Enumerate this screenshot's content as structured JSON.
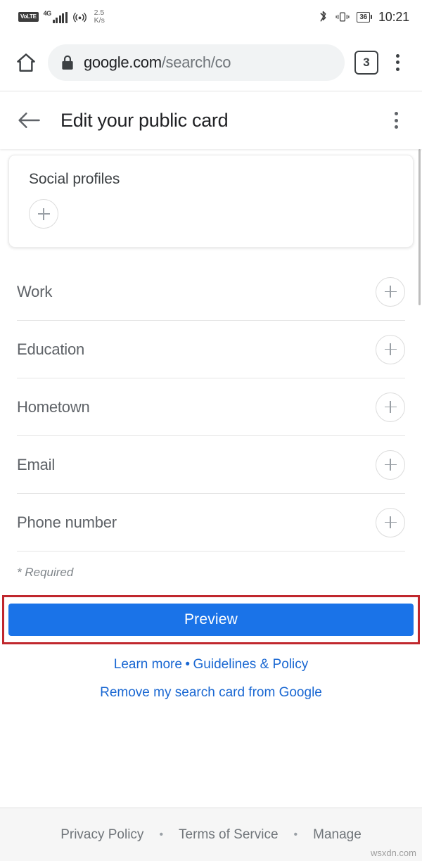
{
  "status_bar": {
    "volte_label": "VoLTE",
    "network_type": "4G",
    "speed_value": "2.5",
    "speed_unit": "K/s",
    "battery_level": "36",
    "clock": "10:21",
    "icons": [
      "volte-badge",
      "signal-bars-icon",
      "hotspot-icon",
      "bluetooth-icon",
      "vibrate-icon",
      "battery-icon"
    ]
  },
  "browser": {
    "home_icon": "home-icon",
    "lock_icon": "lock-icon",
    "url_domain": "google.com",
    "url_path": "/search/co",
    "url_full": "google.com/search/co",
    "tab_count": "3",
    "menu_icon": "overflow-menu-icon"
  },
  "page_header": {
    "back_icon": "back-arrow-icon",
    "title": "Edit your public card",
    "menu_icon": "overflow-menu-icon"
  },
  "social_card": {
    "title": "Social profiles",
    "add_icon": "plus-icon"
  },
  "fields": [
    {
      "label": "Work",
      "add_icon": "plus-icon"
    },
    {
      "label": "Education",
      "add_icon": "plus-icon"
    },
    {
      "label": "Hometown",
      "add_icon": "plus-icon"
    },
    {
      "label": "Email",
      "add_icon": "plus-icon"
    },
    {
      "label": "Phone number",
      "add_icon": "plus-icon"
    }
  ],
  "required_note": "* Required",
  "preview": {
    "label": "Preview",
    "button_color": "#1a73e8",
    "highlight_color": "#c0272d"
  },
  "links": {
    "learn_more": "Learn more",
    "separator": "•",
    "guidelines": "Guidelines & Policy",
    "remove_card": "Remove my search card from Google",
    "link_color": "#1967d2"
  },
  "footer": {
    "privacy": "Privacy Policy",
    "separator": "•",
    "terms": "Terms of Service",
    "manage": "Manage"
  },
  "watermark": "wsxdn.com"
}
